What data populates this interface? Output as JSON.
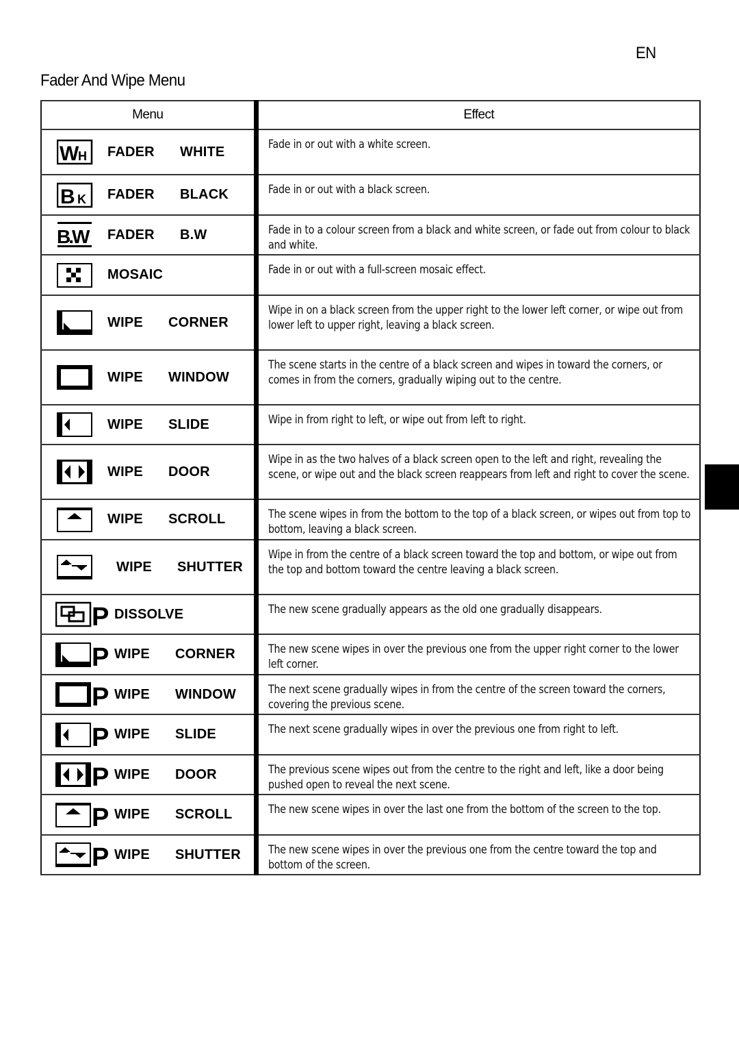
{
  "page": {
    "language_code": "EN",
    "title": "Fader And Wipe Menu"
  },
  "table": {
    "headers": {
      "menu": "Menu",
      "effect": "Effect"
    },
    "rows": [
      {
        "icon": "fader-white-icon",
        "icon_text": "WH",
        "label_1": "FADER",
        "label_2": "WHITE",
        "effect": "Fade in or out with a white screen.",
        "height": 66
      },
      {
        "icon": "fader-black-icon",
        "icon_text": "BK",
        "label_1": "FADER",
        "label_2": "BLACK",
        "effect": "Fade in or out with a black screen.",
        "height": 59
      },
      {
        "icon": "fader-bw-icon",
        "icon_text": "B.W",
        "label_1": "FADER",
        "label_2": "B.W",
        "effect": "Fade in to a colour screen from a black and white screen, or fade out from colour to black and white.",
        "height": 58
      },
      {
        "icon": "mosaic-icon",
        "icon_text": "",
        "label_1": "MOSAIC",
        "label_2": "",
        "effect": "Fade in or out with a full-screen mosaic effect.",
        "height": 59
      },
      {
        "icon": "wipe-corner-icon",
        "icon_text": "",
        "label_1": "WIPE",
        "label_2": "CORNER",
        "effect": "Wipe in on a black screen from the upper right to the lower left corner, or wipe out from lower left to upper right, leaving a black screen.",
        "height": 80
      },
      {
        "icon": "wipe-window-icon",
        "icon_text": "",
        "label_1": "WIPE",
        "label_2": "WINDOW",
        "effect": "The scene starts in the centre of a black screen and wipes in toward the corners, or comes in from the corners, gradually wiping out to the centre.",
        "height": 80
      },
      {
        "icon": "wipe-slide-icon",
        "icon_text": "",
        "label_1": "WIPE",
        "label_2": "SLIDE",
        "effect": "Wipe in from right to left, or wipe out from left to right.",
        "height": 58
      },
      {
        "icon": "wipe-door-icon",
        "icon_text": "",
        "label_1": "WIPE",
        "label_2": "DOOR",
        "effect": "Wipe in as the two halves of a black screen open to the left and right, revealing the scene, or wipe out and the black screen reappears from left and right to cover the scene.",
        "height": 80
      },
      {
        "icon": "wipe-scroll-icon",
        "icon_text": "",
        "label_1": "WIPE",
        "label_2": "SCROLL",
        "effect": "The scene wipes in from the bottom to the top of a black screen, or wipes out from top to bottom, leaving a black screen.",
        "height": 59
      },
      {
        "icon": "wipe-shutter-icon",
        "icon_text": "",
        "label_1": "WIPE",
        "label_2": "SHUTTER",
        "effect": "Wipe in from the centre of a black screen toward the top and bottom, or wipe out from the top and bottom toward the centre leaving a black screen.",
        "height": 80
      },
      {
        "icon": "dissolve-p-icon",
        "icon_text": "P",
        "label_1": "DISSOLVE",
        "label_2": "",
        "effect": "The new scene gradually appears as the old one gradually disappears.",
        "height": 58
      },
      {
        "icon": "wipe-corner-p-icon",
        "icon_text": "P",
        "label_1": "WIPE",
        "label_2": "CORNER",
        "effect": "The new scene wipes in over the previous one from the upper right corner to the lower left corner.",
        "height": 59
      },
      {
        "icon": "wipe-window-p-icon",
        "icon_text": "P",
        "label_1": "WIPE",
        "label_2": "WINDOW",
        "effect": "The next scene gradually wipes in from the centre of the screen toward the corners, covering the previous scene.",
        "height": 58
      },
      {
        "icon": "wipe-slide-p-icon",
        "icon_text": "P",
        "label_1": "WIPE",
        "label_2": "SLIDE",
        "effect": "The next scene gradually wipes in over the previous one from right to left.",
        "height": 59
      },
      {
        "icon": "wipe-door-p-icon",
        "icon_text": "P",
        "label_1": "WIPE",
        "label_2": "DOOR",
        "effect": "The previous scene wipes out from the centre to the right and left, like a door being pushed open to reveal the next scene.",
        "height": 58
      },
      {
        "icon": "wipe-scroll-p-icon",
        "icon_text": "P",
        "label_1": "WIPE",
        "label_2": "SCROLL",
        "effect": "The new scene wipes in over the last one from the bottom of the screen to the top.",
        "height": 59
      },
      {
        "icon": "wipe-shutter-p-icon",
        "icon_text": "P",
        "label_1": "WIPE",
        "label_2": "SHUTTER",
        "effect": "The new scene wipes in over the previous one from the centre toward the top and bottom of the screen.",
        "height": 58
      }
    ]
  }
}
